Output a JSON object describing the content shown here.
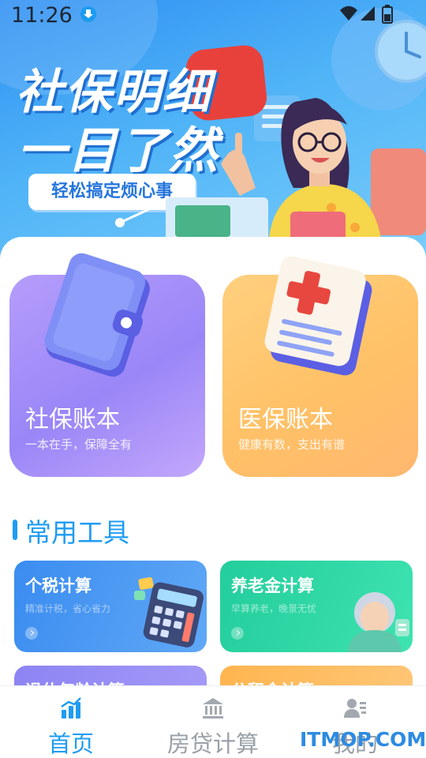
{
  "status_bar": {
    "time": "11:26",
    "icons": [
      "download-icon",
      "wifi-icon",
      "signal-icon",
      "battery-icon"
    ]
  },
  "banner": {
    "headline_line1": "社保明细",
    "headline_line2": "一目了然",
    "tagline": "轻松搞定烦心事"
  },
  "cards": [
    {
      "title": "社保账本",
      "subtitle": "一本在手，保障全有",
      "icon": "wallet-book-icon"
    },
    {
      "title": "医保账本",
      "subtitle": "健康有数，支出有谱",
      "icon": "medical-record-icon"
    }
  ],
  "tools_section": {
    "title": "常用工具",
    "items": [
      {
        "title": "个税计算",
        "subtitle": "精准计税，省心省力",
        "icon": "calculator-icon"
      },
      {
        "title": "养老金计算",
        "subtitle": "早算养老，晚景无忧",
        "icon": "elderly-woman-icon"
      },
      {
        "title": "退休年龄计算",
        "subtitle": "",
        "icon": ""
      },
      {
        "title": "公积金计算",
        "subtitle": "",
        "icon": ""
      }
    ]
  },
  "bottom_nav": [
    {
      "label": "首页",
      "icon": "chart-bars-icon",
      "active": true
    },
    {
      "label": "房贷计算",
      "icon": "bank-icon",
      "active": false
    },
    {
      "label": "我的",
      "icon": "profile-card-icon",
      "active": false
    }
  ],
  "watermark": "ITMOP.COM",
  "colors": {
    "accent": "#1f9cf3",
    "nav_inactive": "#9aa0a8",
    "card_purple": "#9a86f7",
    "card_yellow": "#ffc167",
    "tool_blue": "#3a8cf0",
    "tool_green": "#23cd9c",
    "headline_red": "#e8413c"
  }
}
